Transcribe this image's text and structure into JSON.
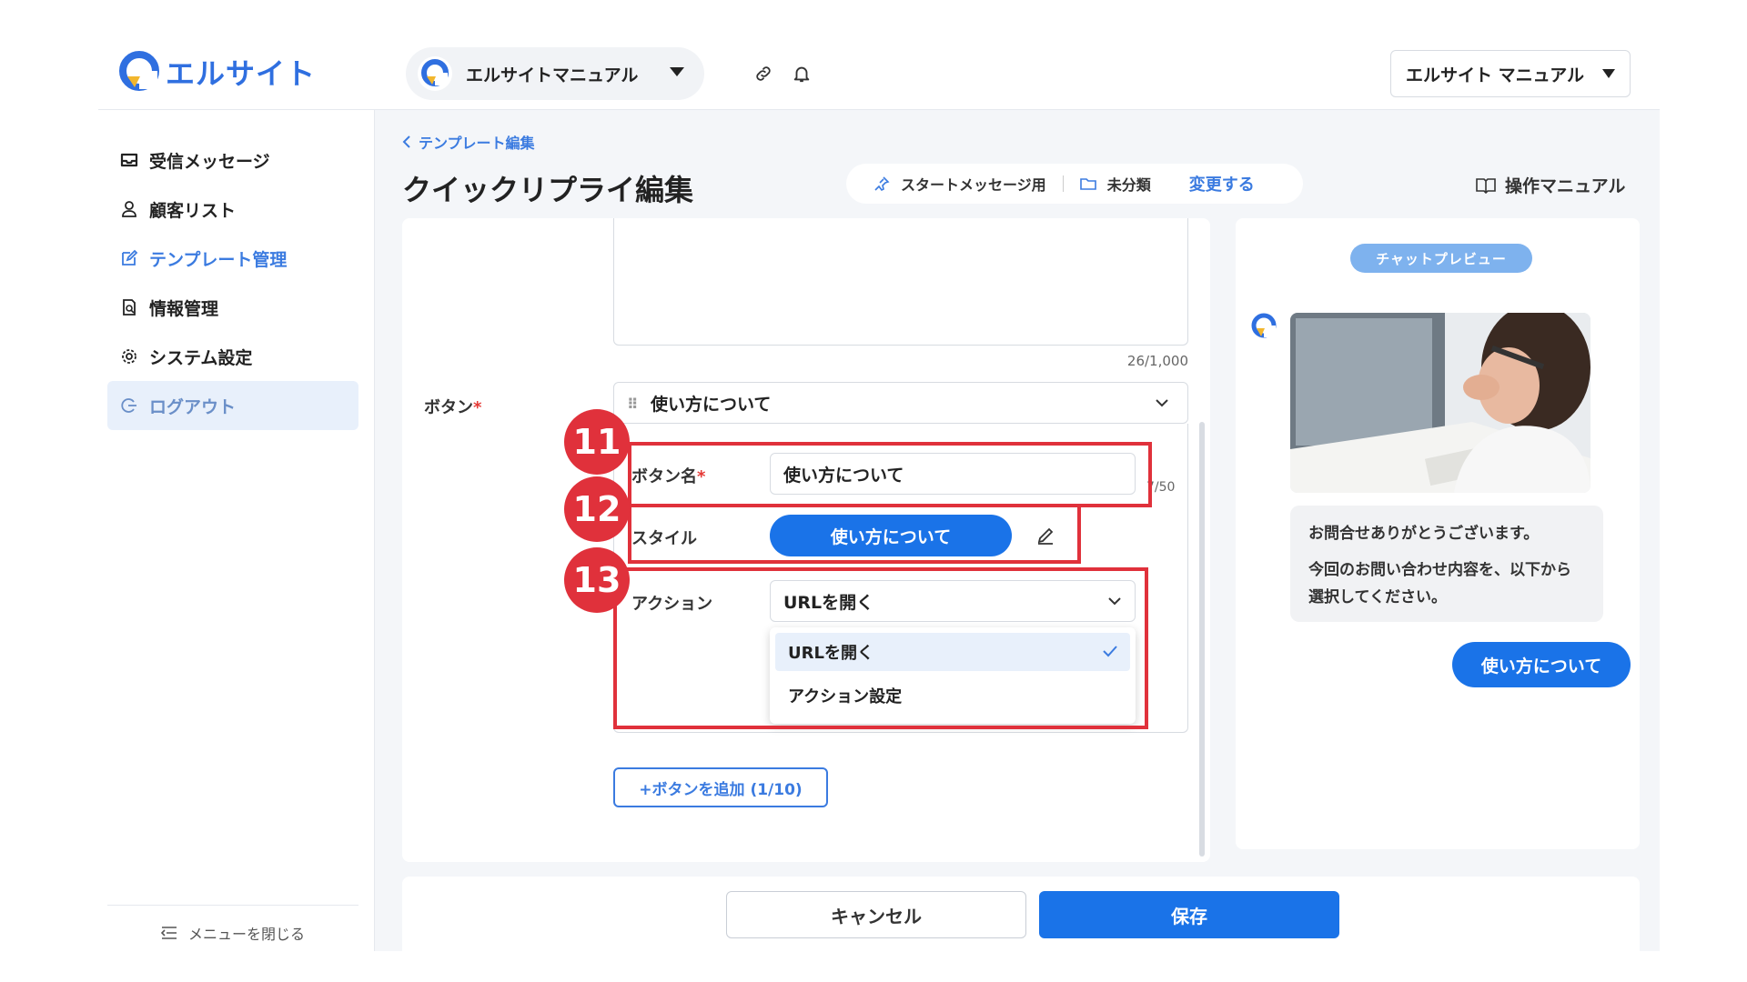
{
  "header": {
    "logo_text": "エルサイト",
    "account_pill_name": "エルサイトマニュアル",
    "account_select": "エルサイト マニュアル"
  },
  "sidebar": {
    "items": [
      {
        "label": "受信メッセージ",
        "icon": "inbox-icon"
      },
      {
        "label": "顧客リスト",
        "icon": "user-icon"
      },
      {
        "label": "テンプレート管理",
        "icon": "edit-icon"
      },
      {
        "label": "情報管理",
        "icon": "document-search-icon"
      },
      {
        "label": "システム設定",
        "icon": "gear-icon"
      },
      {
        "label": "ログアウト",
        "icon": "logout-icon"
      }
    ],
    "collapse_label": "メニューを閉じる"
  },
  "page": {
    "breadcrumb": "テンプレート編集",
    "title": "クイックリプライ編集",
    "meta": {
      "start_message": "スタートメッセージ用",
      "folder": "未分類",
      "change": "変更する"
    },
    "manual_link": "操作マニュアル"
  },
  "editor": {
    "char_count": "26/1,000",
    "button_label": "ボタン",
    "required_mark": "*",
    "button_accordion_title": "使い方について",
    "button_name_label": "ボタン名",
    "button_name_value": "使い方について",
    "button_name_count": "7/50",
    "style_label": "スタイル",
    "style_preview": "使い方について",
    "action_label": "アクション",
    "action_value": "URLを開く",
    "action_options": [
      "URLを開く",
      "アクション設定"
    ],
    "add_button": "+ボタンを追加 (1/10)"
  },
  "annotations": [
    "11",
    "12",
    "13"
  ],
  "preview": {
    "tag": "チャットプレビュー",
    "message_line1": "お問合せありがとうございます。",
    "message_line2": "今回のお問い合わせ内容を、以下から選択してください。",
    "quick_reply": "使い方について"
  },
  "footer": {
    "cancel": "キャンセル",
    "save": "保存"
  },
  "colors": {
    "accent": "#1a73e8",
    "highlight": "#e0313b",
    "link": "#3b7be0"
  }
}
